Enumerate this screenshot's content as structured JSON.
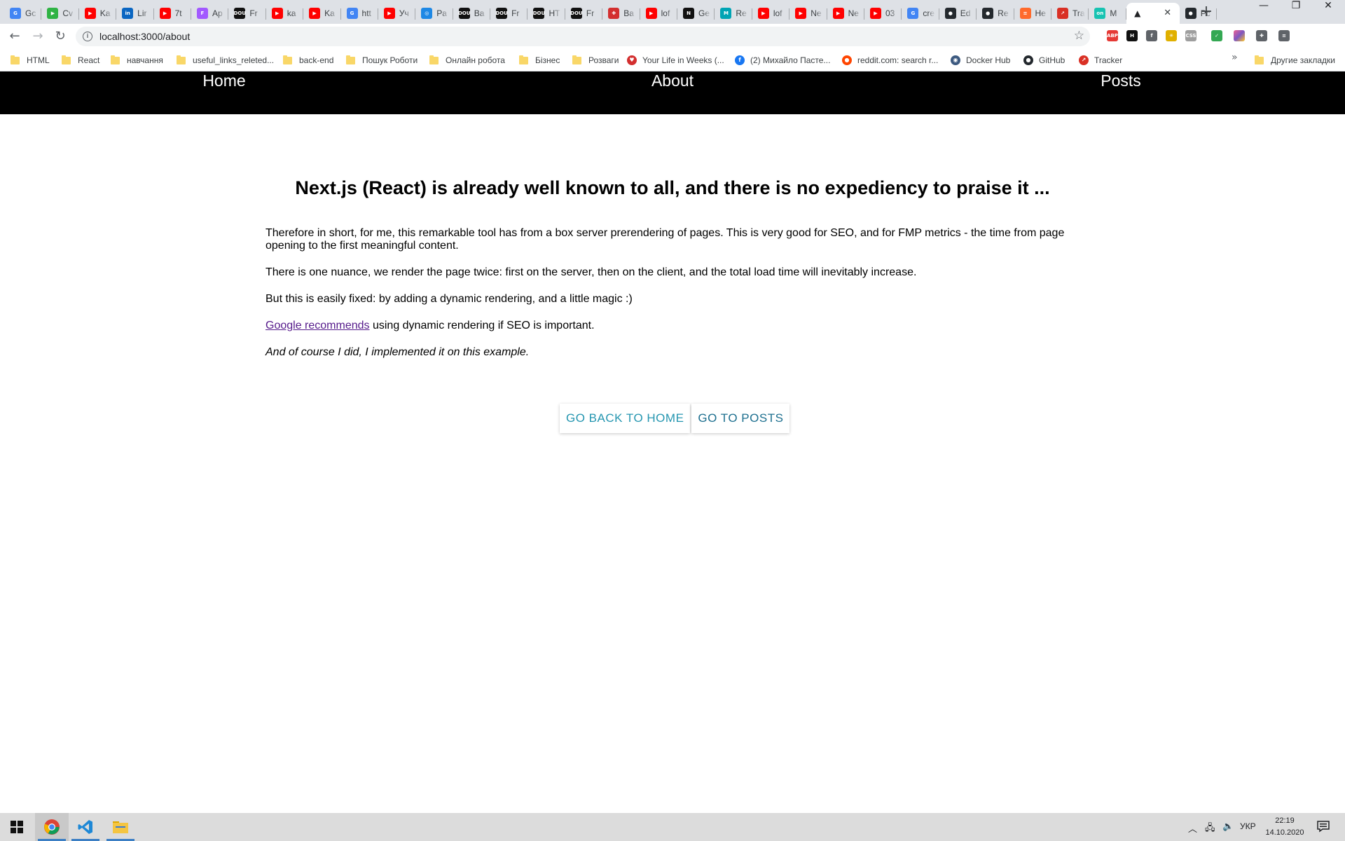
{
  "browser": {
    "tabs": [
      {
        "title": "Gc",
        "color": "#4285f4",
        "glyph": "G"
      },
      {
        "title": "Cv",
        "color": "#2fb344",
        "glyph": "▶"
      },
      {
        "title": "Ka",
        "color": "#ff0000",
        "glyph": "▶"
      },
      {
        "title": "Lir",
        "color": "#0a66c2",
        "glyph": "in"
      },
      {
        "title": "7t",
        "color": "#ff0000",
        "glyph": "▶"
      },
      {
        "title": "Ap",
        "color": "#a259ff",
        "glyph": "F"
      },
      {
        "title": "Fr",
        "color": "#111111",
        "glyph": "DOU"
      },
      {
        "title": "ka",
        "color": "#ff0000",
        "glyph": "▶"
      },
      {
        "title": "Ka",
        "color": "#ff0000",
        "glyph": "▶"
      },
      {
        "title": "htt",
        "color": "#4285f4",
        "glyph": "G"
      },
      {
        "title": "Уч",
        "color": "#ff0000",
        "glyph": "▶"
      },
      {
        "title": "Pa",
        "color": "#1e88e5",
        "glyph": "◎"
      },
      {
        "title": "Ba",
        "color": "#111111",
        "glyph": "DOU"
      },
      {
        "title": "Fr",
        "color": "#111111",
        "glyph": "DOU"
      },
      {
        "title": "HT",
        "color": "#111111",
        "glyph": "DOU"
      },
      {
        "title": "Fr",
        "color": "#111111",
        "glyph": "DOU"
      },
      {
        "title": "Ba",
        "color": "#d32f2f",
        "glyph": "✚"
      },
      {
        "title": "lof",
        "color": "#ff0000",
        "glyph": "▶"
      },
      {
        "title": "Ge",
        "color": "#111111",
        "glyph": "N"
      },
      {
        "title": "Re",
        "color": "#00a4b4",
        "glyph": "M"
      },
      {
        "title": "lof",
        "color": "#ff0000",
        "glyph": "▶"
      },
      {
        "title": "Ne",
        "color": "#ff0000",
        "glyph": "▶"
      },
      {
        "title": "Ne",
        "color": "#ff0000",
        "glyph": "▶"
      },
      {
        "title": "03",
        "color": "#ff0000",
        "glyph": "▶"
      },
      {
        "title": "cre",
        "color": "#4285f4",
        "glyph": "G"
      },
      {
        "title": "Ed",
        "color": "#24292e",
        "glyph": "●"
      },
      {
        "title": "Re",
        "color": "#24292e",
        "glyph": "●"
      },
      {
        "title": "He",
        "color": "#ff6a2b",
        "glyph": "≡"
      },
      {
        "title": "Tra",
        "color": "#d93025",
        "glyph": "↗"
      },
      {
        "title": "M",
        "color": "#17c3b2",
        "glyph": "on"
      }
    ],
    "active_tab": {
      "title": "",
      "glyph": "▲"
    },
    "after_tab": {
      "title": "Pc",
      "color": "#24292e",
      "glyph": "●"
    },
    "new_tab_label": "+",
    "url": "localhost:3000/about",
    "bookmarks": [
      {
        "label": "HTML",
        "kind": "folder"
      },
      {
        "label": "React",
        "kind": "folder"
      },
      {
        "label": "навчання",
        "kind": "folder"
      },
      {
        "label": "useful_links_releted...",
        "kind": "folder"
      },
      {
        "label": "back-end",
        "kind": "folder"
      },
      {
        "label": "Пошук Роботи",
        "kind": "folder"
      },
      {
        "label": "Онлайн робота",
        "kind": "folder"
      },
      {
        "label": "Бізнес",
        "kind": "folder"
      },
      {
        "label": "Розваги",
        "kind": "folder"
      },
      {
        "label": "Your Life in Weeks (...",
        "kind": "icon",
        "color": "#d32f2f",
        "glyph": "♥"
      },
      {
        "label": "(2) Михайло Пасте...",
        "kind": "icon",
        "color": "#1877f2",
        "glyph": "f"
      },
      {
        "label": "reddit.com: search r...",
        "kind": "icon",
        "color": "#ff4500",
        "glyph": "●"
      },
      {
        "label": "Docker Hub",
        "kind": "icon",
        "color": "#3d5a80",
        "glyph": "◉"
      },
      {
        "label": "GitHub",
        "kind": "icon",
        "color": "#24292e",
        "glyph": "●"
      },
      {
        "label": "Tracker",
        "kind": "icon",
        "color": "#d93025",
        "glyph": "↗"
      }
    ],
    "bookmarks_more": "»",
    "other_bookmarks": "Другие закладки",
    "extensions": [
      {
        "name": "adblock-icon",
        "color": "#e53935",
        "glyph": "ABP"
      },
      {
        "name": "h-extension-icon",
        "color": "#111111",
        "glyph": "H"
      },
      {
        "name": "facebook-ext-icon",
        "color": "#5f6368",
        "glyph": "f"
      },
      {
        "name": "colorzilla-icon",
        "color": "#e0b000",
        "glyph": "✳"
      },
      {
        "name": "grey-ext-icon",
        "color": "#9e9e9e",
        "glyph": "CSS"
      },
      {
        "name": "shield-ext-icon",
        "color": "#34a853",
        "glyph": "✓"
      },
      {
        "name": "gradient-ext-icon",
        "color": "#c05ad0",
        "glyph": ""
      },
      {
        "name": "puzzle-icon",
        "color": "#5f6368",
        "glyph": "✚"
      },
      {
        "name": "reading-list-icon",
        "color": "#5f6368",
        "glyph": "≡"
      }
    ]
  },
  "site": {
    "nav": [
      "Home",
      "About",
      "Posts"
    ],
    "heading": "Next.js (React) is already well known to all, and there is no expediency to praise it ...",
    "p1": "Therefore in short, for me, this remarkable tool has from a box server prerendering of pages. This is very good for SEO, and for FMP metrics - the time from page opening to the first meaningful content.",
    "p2": "There is one nuance, we render the page twice: first on the server, then on the client, and the total load time will inevitably increase.",
    "p3": "But this is easily fixed: by adding a dynamic rendering, and a little magic :)",
    "p4_link": "Google recommends",
    "p4_rest": " using dynamic rendering if SEO is important.",
    "p5": "And of course I did, I implemented it on this example.",
    "btn_home": "GO BACK TO HOME",
    "btn_posts": "GO TO POSTS",
    "link_color": "#551a8b",
    "button_color": "#2596b0"
  },
  "taskbar": {
    "apps": [
      "windows-start",
      "chrome",
      "vscode",
      "file-explorer"
    ],
    "lang": "УКР",
    "time": "22:19",
    "date": "14.10.2020"
  }
}
